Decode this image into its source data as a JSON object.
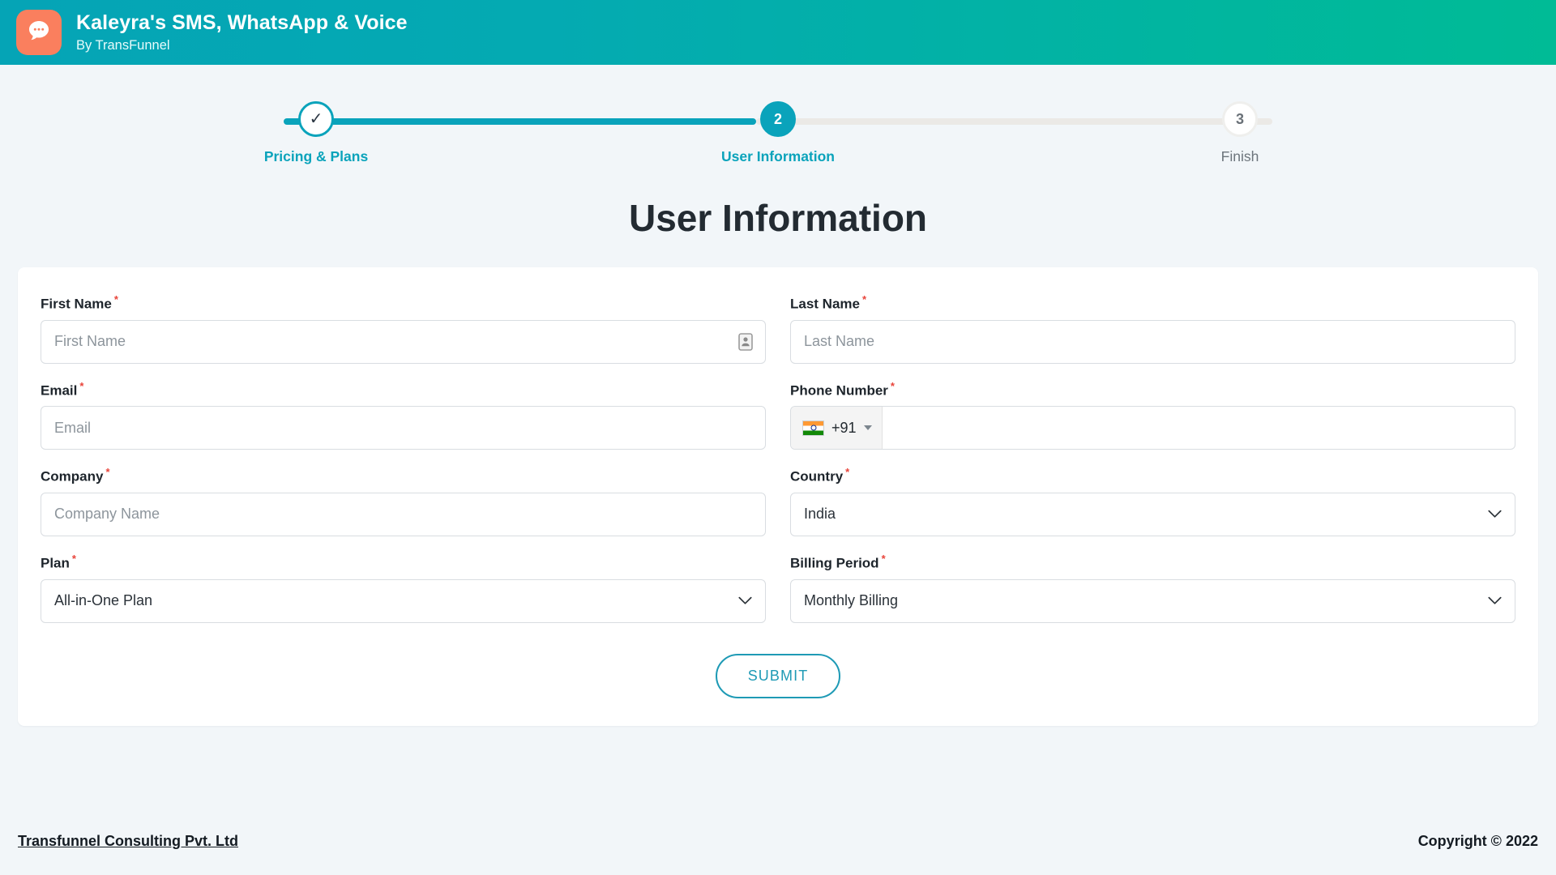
{
  "header": {
    "title": "Kaleyra's SMS, WhatsApp & Voice",
    "subtitle": "By TransFunnel",
    "logo_icon": "chat-bubble-icon",
    "brand_color": "#05a4b6",
    "logo_color": "#fa7f5e"
  },
  "stepper": {
    "accent_color": "#0aa3bb",
    "steps": [
      {
        "indicator": "✓",
        "label": "Pricing & Plans",
        "state": "completed"
      },
      {
        "indicator": "2",
        "label": "User Information",
        "state": "active"
      },
      {
        "indicator": "3",
        "label": "Finish",
        "state": "upcoming"
      }
    ]
  },
  "page": {
    "title": "User Information"
  },
  "form": {
    "required_marker": "*",
    "fields": {
      "first_name": {
        "label": "First Name",
        "placeholder": "First Name",
        "value": "",
        "icon": "contact-card-icon"
      },
      "last_name": {
        "label": "Last Name",
        "placeholder": "Last Name",
        "value": ""
      },
      "email": {
        "label": "Email",
        "placeholder": "Email",
        "value": ""
      },
      "phone": {
        "label": "Phone Number",
        "placeholder": "",
        "value": "",
        "country_code": "+91",
        "flag": "india-flag-icon"
      },
      "company": {
        "label": "Company",
        "placeholder": "Company Name",
        "value": ""
      },
      "country": {
        "label": "Country",
        "value": "India"
      },
      "plan": {
        "label": "Plan",
        "value": "All-in-One Plan"
      },
      "billing": {
        "label": "Billing Period",
        "value": "Monthly Billing"
      }
    },
    "submit_label": "SUBMIT"
  },
  "footer": {
    "company_link": "Transfunnel Consulting Pvt. Ltd",
    "copyright": "Copyright © 2022"
  }
}
